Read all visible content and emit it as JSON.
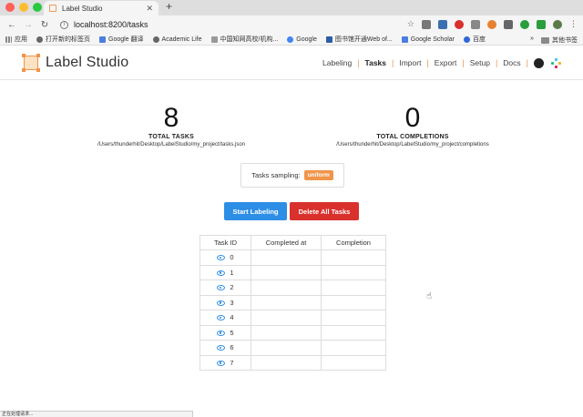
{
  "browser": {
    "tab_title": "Label Studio",
    "tab_close": "✕",
    "new_tab": "+",
    "url": "localhost:8200/tasks",
    "bookmarks": [
      "应用",
      "打开新的标签页",
      "Google 翻译",
      "Academic Life",
      "中国知网高校/机构...",
      "Google",
      "图书馆开通Web of...",
      "Google Scholar",
      "百度"
    ],
    "bookmarks_more": "»",
    "bookmarks_other": "其他书签"
  },
  "header": {
    "logo_text": "Label Studio",
    "nav": [
      "Labeling",
      "Tasks",
      "Import",
      "Export",
      "Setup",
      "Docs"
    ],
    "active": "Tasks"
  },
  "stats": {
    "total_tasks": {
      "value": "8",
      "label": "TOTAL TASKS",
      "path": "/Users/thunderhit/Desktop/LabelStudio/my_project/tasks.json"
    },
    "total_completions": {
      "value": "0",
      "label": "TOTAL COMPLETIONS",
      "path": "/Users/thunderhit/Desktop/LabelStudio/my_project/completions"
    }
  },
  "sampling": {
    "label": "Tasks sampling:",
    "value": "uniform"
  },
  "buttons": {
    "start": "Start Labeling",
    "delete": "Delete All Tasks"
  },
  "table": {
    "headers": [
      "Task ID",
      "Completed at",
      "Completion"
    ],
    "rows": [
      {
        "id": "0",
        "completed_at": "",
        "completion": ""
      },
      {
        "id": "1",
        "completed_at": "",
        "completion": ""
      },
      {
        "id": "2",
        "completed_at": "",
        "completion": ""
      },
      {
        "id": "3",
        "completed_at": "",
        "completion": ""
      },
      {
        "id": "4",
        "completed_at": "",
        "completion": ""
      },
      {
        "id": "5",
        "completed_at": "",
        "completion": ""
      },
      {
        "id": "6",
        "completed_at": "",
        "completion": ""
      },
      {
        "id": "7",
        "completed_at": "",
        "completion": ""
      }
    ]
  },
  "status_bar": "正在处理请求..."
}
